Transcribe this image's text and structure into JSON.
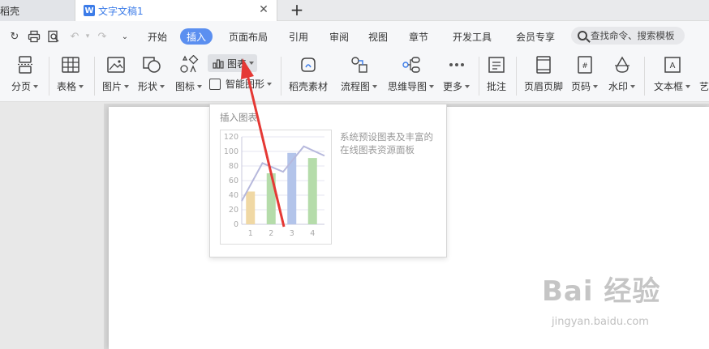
{
  "tabs": [
    {
      "label": "稻壳"
    },
    {
      "label": "文字文稿1",
      "icon": "W"
    }
  ],
  "menu": {
    "items": [
      "开始",
      "插入",
      "页面布局",
      "引用",
      "审阅",
      "视图",
      "章节",
      "开发工具",
      "会员专享"
    ],
    "active": "插入",
    "search_placeholder": "查找命令、搜索模板"
  },
  "ribbon": {
    "page_break": "分页",
    "table": "表格",
    "picture": "图片",
    "shape": "形状",
    "icons": "图标",
    "chart": "图表",
    "smart_graphic": "智能图形",
    "docer_material": "稻壳素材",
    "flowchart": "流程图",
    "mindmap": "思维导图",
    "more": "更多",
    "comment": "批注",
    "header_footer": "页眉页脚",
    "page_number": "页码",
    "watermark": "水印",
    "textbox": "文本框",
    "art": "艺"
  },
  "tooltip": {
    "title": "插入图表",
    "description": "系统预设图表及丰富的在线图表资源面板"
  },
  "chart_data": {
    "type": "bar",
    "categories": [
      "1",
      "2",
      "3",
      "4"
    ],
    "values": [
      45,
      70,
      98,
      91
    ],
    "line_values": [
      32,
      84,
      72,
      107,
      94
    ],
    "ylim": [
      0,
      120
    ],
    "yticks": [
      "0",
      "20",
      "40",
      "60",
      "80",
      "100",
      "120"
    ],
    "bar_colors": [
      "#f0d8a4",
      "#b5dcaa",
      "#b3c4ea",
      "#b5dcaa"
    ],
    "line_color": "#b6b8dc"
  },
  "watermark": {
    "big": "Bai 经验",
    "small": "jingyan.baidu.com"
  },
  "colors": {
    "accent": "#5b8ff0",
    "arrow": "#e53935"
  }
}
